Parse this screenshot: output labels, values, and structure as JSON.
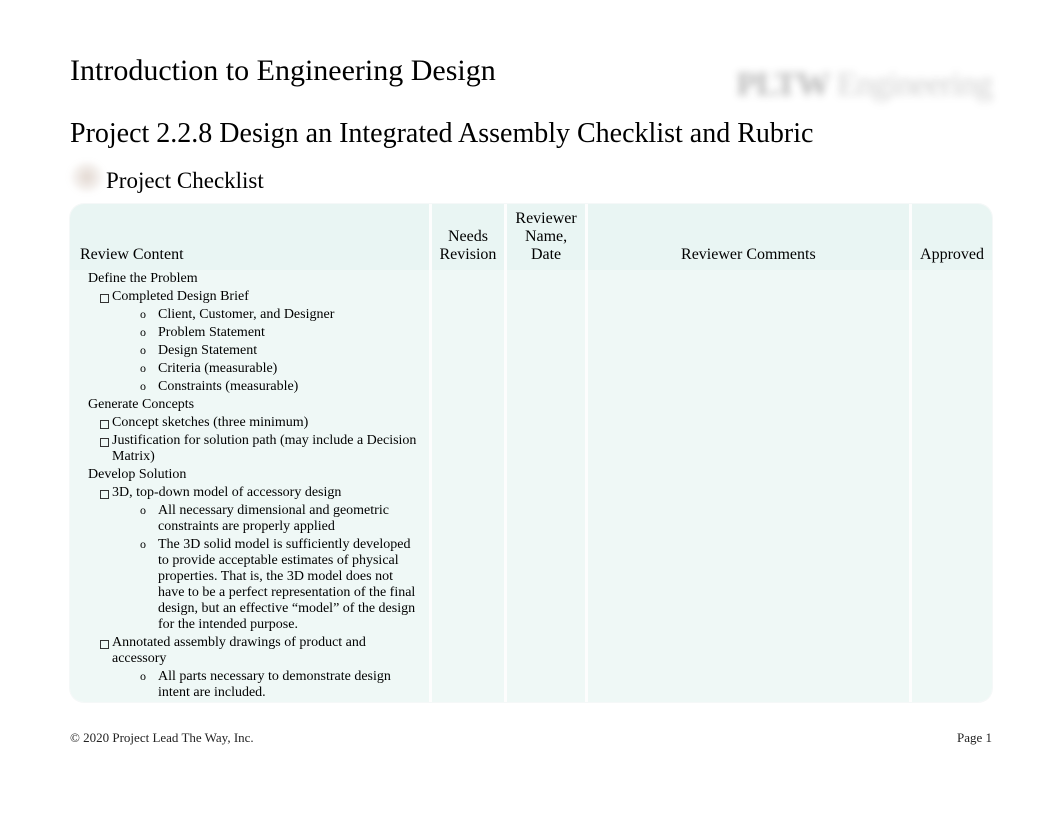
{
  "header": {
    "title": "Introduction to Engineering Design",
    "subtitle": "Project 2.2.8 Design an Integrated Assembly Checklist and Rubric",
    "logo_bold": "PLTW",
    "logo_light": "Engineering"
  },
  "section": {
    "title": "Project Checklist"
  },
  "table": {
    "headers": {
      "review": "Review Content",
      "needs": "Needs Revision",
      "reviewer": "Reviewer Name, Date",
      "comments": "Reviewer Comments",
      "approved": "Approved"
    },
    "rows": [
      {
        "cls": "cat",
        "text": "Define the Problem"
      },
      {
        "cls": "lvl1",
        "text": "Completed Design Brief"
      },
      {
        "cls": "lvl2",
        "text": "Client, Customer, and Designer"
      },
      {
        "cls": "lvl2",
        "text": "Problem Statement"
      },
      {
        "cls": "lvl2",
        "text": "Design Statement"
      },
      {
        "cls": "lvl2",
        "text": "Criteria (measurable)"
      },
      {
        "cls": "lvl2",
        "text": "Constraints (measurable)"
      },
      {
        "cls": "cat",
        "text": "Generate Concepts"
      },
      {
        "cls": "lvl1",
        "text": "Concept sketches (three minimum)"
      },
      {
        "cls": "lvl1",
        "text": "Justification for solution path (may include a Decision Matrix)"
      },
      {
        "cls": "cat",
        "text": "Develop Solution"
      },
      {
        "cls": "lvl1",
        "text": "3D, top-down model of accessory design"
      },
      {
        "cls": "lvl2",
        "text": "All necessary dimensional and geometric constraints are properly applied"
      },
      {
        "cls": "lvl2",
        "text": "The 3D solid model is sufficiently developed to provide acceptable estimates of physical properties. That is, the 3D model does not have to be a perfect representation of the final design, but an effective “model” of the design for the intended purpose."
      },
      {
        "cls": "lvl1",
        "text": "Annotated assembly drawings of product and accessory"
      },
      {
        "cls": "lvl2",
        "text": "All parts necessary to demonstrate design intent are included."
      }
    ]
  },
  "footer": {
    "copyright": "© 2020 Project Lead The Way, Inc.",
    "page": "Page 1"
  }
}
